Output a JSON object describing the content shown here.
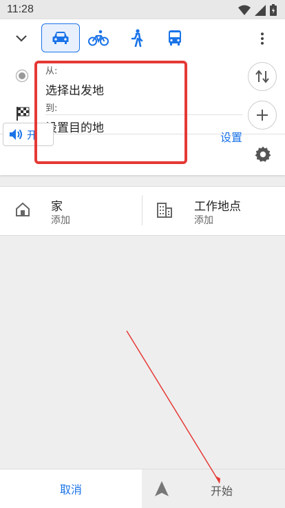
{
  "status_bar": {
    "time": "11:28"
  },
  "route": {
    "from_label": "从:",
    "from_value": "选择出发地",
    "to_label": "到:",
    "to_value": "设置目的地"
  },
  "options": {
    "voice_label": "开",
    "settings_label": "设置"
  },
  "places": [
    {
      "title": "家",
      "subtitle": "添加"
    },
    {
      "title": "工作地点",
      "subtitle": "添加"
    }
  ],
  "bottom": {
    "cancel_label": "取消",
    "start_label": "开始"
  },
  "colors": {
    "accent": "#1a73e8",
    "annotation": "#e53935"
  }
}
